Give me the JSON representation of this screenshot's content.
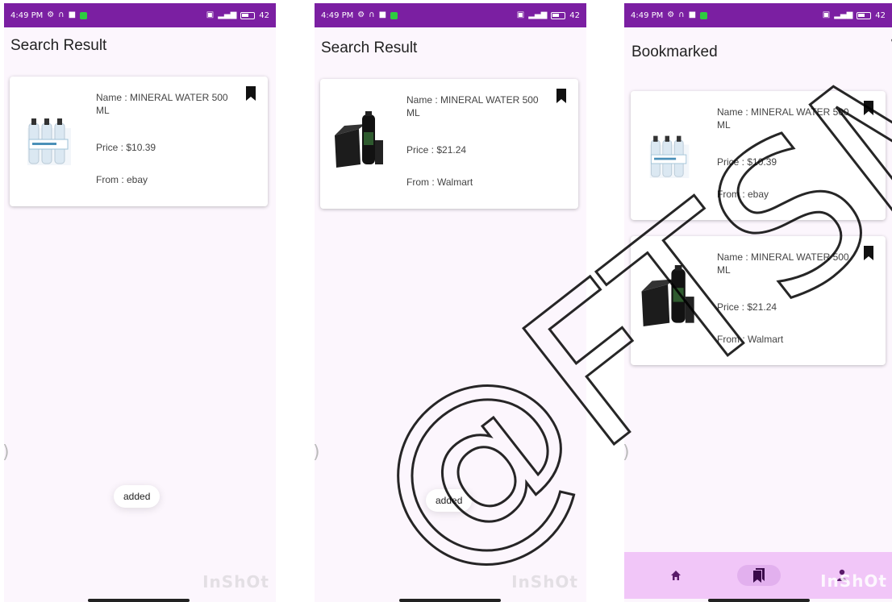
{
  "status_bar": {
    "time": "4:49 PM",
    "battery": "42",
    "color": "#7b1fa2"
  },
  "screens": [
    {
      "title": "Search Result",
      "toast": "added",
      "items": [
        {
          "name": "Name : MINERAL WATER 500 ML",
          "price": "Price : $10.39",
          "from": "From : ebay",
          "image": "water-bottle-pack"
        }
      ]
    },
    {
      "title": "Search Result",
      "toast": "added",
      "items": [
        {
          "name": "Name : MINERAL WATER 500 ML",
          "price": "Price : $21.24",
          "from": "From : Walmart",
          "image": "black-bottle-box"
        }
      ]
    },
    {
      "title": "Bookmarked",
      "items": [
        {
          "name": "Name : MINERAL WATER 500 ML",
          "price": "Price : $10.39",
          "from": "From : ebay",
          "image": "water-bottle-pack"
        },
        {
          "name": "Name : MINERAL WATER 500 ML",
          "price": "Price : $21.24",
          "from": "From : Walmart",
          "image": "black-bottle-box"
        }
      ],
      "bottom_nav": [
        "home-icon",
        "bookmarks-icon",
        "profile-icon"
      ]
    }
  ],
  "watermarks": {
    "inshot": "InShOt",
    "overlay": "@FTSM"
  },
  "colors": {
    "accent": "#7b1fa2",
    "screen_bg": "#fcf6fd",
    "bottom_nav_bg": "#f1c6f8"
  }
}
